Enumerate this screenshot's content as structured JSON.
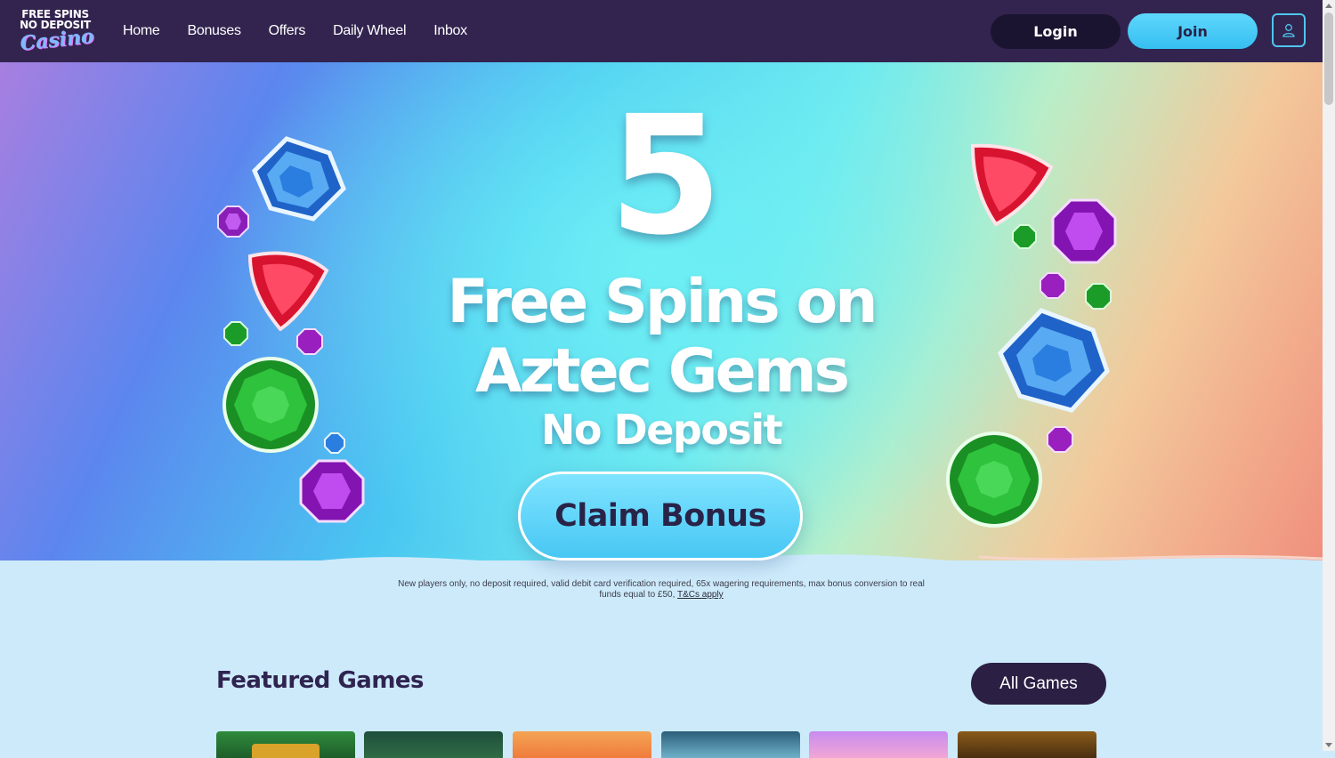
{
  "header": {
    "logo": {
      "line1": "FREE SPINS",
      "line2": "NO DEPOSIT",
      "line3": "Casino"
    },
    "nav": [
      {
        "label": "Home"
      },
      {
        "label": "Bonuses"
      },
      {
        "label": "Offers"
      },
      {
        "label": "Daily Wheel"
      },
      {
        "label": "Inbox"
      }
    ],
    "login_label": "Login",
    "join_label": "Join",
    "account_icon": "user-icon"
  },
  "hero": {
    "number": "5",
    "line1": "Free Spins on",
    "line2": "Aztec Gems",
    "line3": "No Deposit",
    "cta_label": "Claim Bonus",
    "disclaimer": "New players only, no deposit required, valid debit card verification required, 65x wagering requirements, max bonus conversion to real funds equal to £50, ",
    "terms_link": "T&Cs apply",
    "gem_colors": {
      "blue": "#2f7fe0",
      "red": "#e8213f",
      "green": "#23b02f",
      "purple": "#9b22c8"
    }
  },
  "featured": {
    "title": "Featured Games",
    "all_games_label": "All Games",
    "tiles": [
      {
        "icon": "game-thumbnail-1"
      },
      {
        "icon": "game-thumbnail-2"
      },
      {
        "icon": "game-thumbnail-3"
      },
      {
        "icon": "game-thumbnail-4"
      },
      {
        "icon": "game-thumbnail-5"
      },
      {
        "icon": "game-thumbnail-6"
      }
    ]
  },
  "colors": {
    "header_bg": "#32244f",
    "accent": "#48c7f4",
    "dark_button": "#2b1f44"
  }
}
